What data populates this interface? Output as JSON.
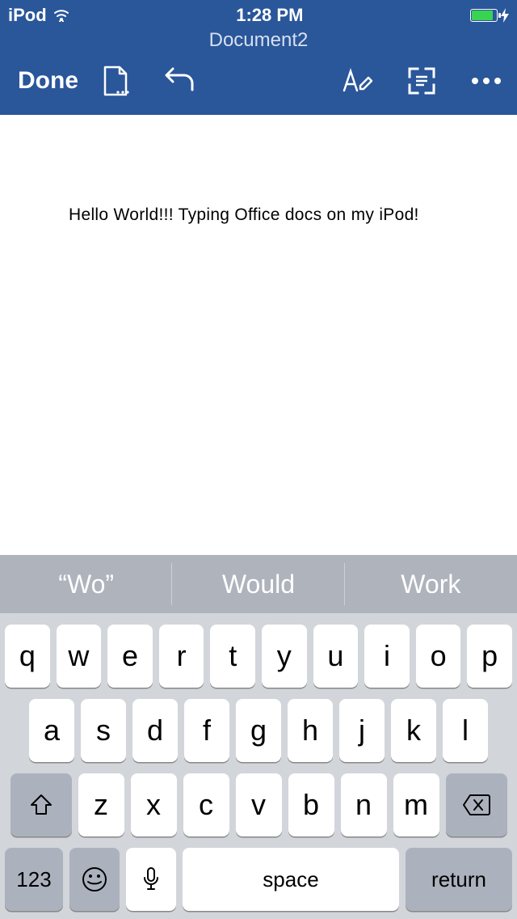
{
  "statusbar": {
    "carrier": "iPod",
    "time": "1:28 PM"
  },
  "header": {
    "title": "Document2",
    "done_label": "Done"
  },
  "document": {
    "text": "Hello World!!! Typing Office docs on my iPod!"
  },
  "keyboard": {
    "suggestions": [
      "“Wo”",
      "Would",
      "Work"
    ],
    "row1": [
      "q",
      "w",
      "e",
      "r",
      "t",
      "y",
      "u",
      "i",
      "o",
      "p"
    ],
    "row2": [
      "a",
      "s",
      "d",
      "f",
      "g",
      "h",
      "j",
      "k",
      "l"
    ],
    "row3": [
      "z",
      "x",
      "c",
      "v",
      "b",
      "n",
      "m"
    ],
    "numkey": "123",
    "space_label": "space",
    "return_label": "return"
  }
}
